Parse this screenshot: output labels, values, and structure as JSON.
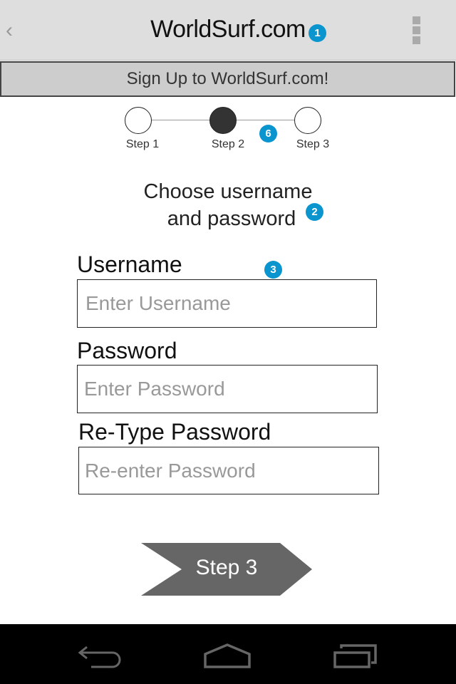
{
  "appbar": {
    "title": "WorldSurf.com",
    "back_icon": "chevron-left-icon",
    "menu_icon": "overflow-menu-icon"
  },
  "banner": "Sign Up to WorldSurf.com!",
  "stepper": {
    "steps": [
      "Step 1",
      "Step 2",
      "Step 3"
    ],
    "current": 2
  },
  "heading": {
    "line1": "Choose username",
    "line2": "and password"
  },
  "form": {
    "username": {
      "label": "Username",
      "placeholder": "Enter Username",
      "value": ""
    },
    "password": {
      "label": "Password",
      "placeholder": "Enter Password",
      "value": ""
    },
    "retype": {
      "label": "Re-Type Password",
      "placeholder": "Re-enter Password",
      "value": ""
    }
  },
  "next_button": "Step 3",
  "annotations": [
    "1",
    "6",
    "2",
    "3"
  ],
  "colors": {
    "badge": "#0a95cf",
    "button": "#666666"
  }
}
